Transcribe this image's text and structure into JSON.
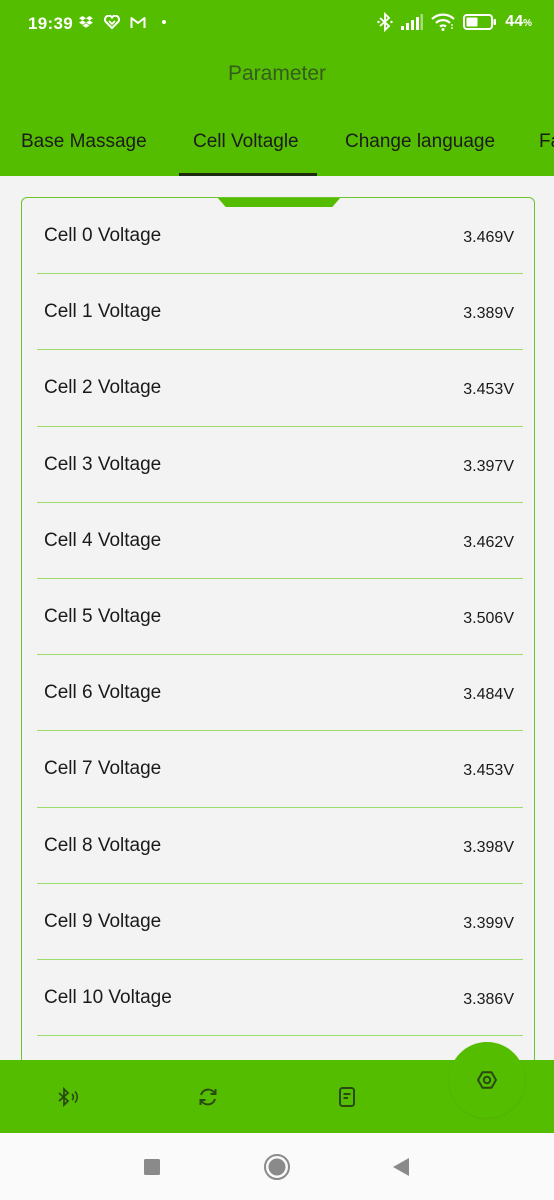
{
  "status_bar": {
    "time": "19:39",
    "battery_percent": "44",
    "battery_unit": "%",
    "icons_left": [
      "dropbox-icon",
      "app-icon",
      "gmail-icon",
      "dot-icon"
    ],
    "icons_right": [
      "bluetooth-icon",
      "signal-icon",
      "wifi-icon",
      "battery-icon"
    ]
  },
  "header": {
    "title": "Parameter"
  },
  "tabs": [
    {
      "label": "Base Massage",
      "active": false
    },
    {
      "label": "Cell Voltagle",
      "active": true
    },
    {
      "label": "Change language",
      "active": false
    },
    {
      "label": "Fa",
      "active": false
    }
  ],
  "cells": [
    {
      "label": "Cell 0 Voltage",
      "value": "3.469V"
    },
    {
      "label": "Cell 1 Voltage",
      "value": "3.389V"
    },
    {
      "label": "Cell 2 Voltage",
      "value": "3.453V"
    },
    {
      "label": "Cell 3 Voltage",
      "value": "3.397V"
    },
    {
      "label": "Cell 4 Voltage",
      "value": "3.462V"
    },
    {
      "label": "Cell 5 Voltage",
      "value": "3.506V"
    },
    {
      "label": "Cell 6 Voltage",
      "value": "3.484V"
    },
    {
      "label": "Cell 7 Voltage",
      "value": "3.453V"
    },
    {
      "label": "Cell 8 Voltage",
      "value": "3.398V"
    },
    {
      "label": "Cell 9 Voltage",
      "value": "3.399V"
    },
    {
      "label": "Cell 10 Voltage",
      "value": "3.386V"
    }
  ],
  "bottom_bar": {
    "buttons": [
      "bluetooth-connect-icon",
      "refresh-icon",
      "document-icon"
    ],
    "fab": "settings-icon"
  },
  "system_nav": [
    "recents-button",
    "home-button",
    "back-button"
  ],
  "colors": {
    "primary_green": "#55bd00",
    "divider_green": "#9bdb6a",
    "background": "#f3f3f3"
  }
}
